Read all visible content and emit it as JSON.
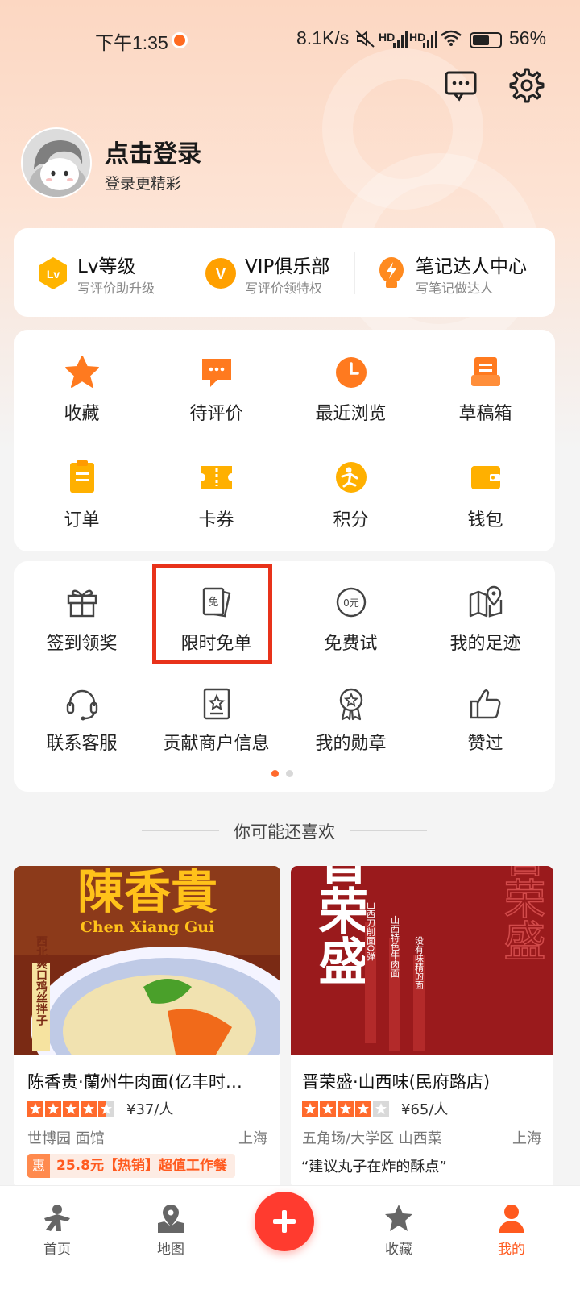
{
  "status_bar": {
    "time": "下午1:35",
    "network_speed": "8.1K/s",
    "signal_1": "HD",
    "signal_2": "HD",
    "battery": "56%"
  },
  "header": {
    "messages_icon": "chat-bubble-icon",
    "settings_icon": "gear-icon"
  },
  "profile": {
    "title": "点击登录",
    "subtitle": "登录更精彩"
  },
  "levels": [
    {
      "title": "Lv等级",
      "subtitle": "写评价助升级",
      "icon": "lv-badge-icon",
      "badge_text": "Lv"
    },
    {
      "title": "VIP俱乐部",
      "subtitle": "写评价领特权",
      "icon": "vip-badge-icon",
      "badge_text": "V"
    },
    {
      "title": "笔记达人中心",
      "subtitle": "写笔记做达人",
      "icon": "lightning-bulb-icon"
    }
  ],
  "grid1": [
    {
      "label": "收藏",
      "icon": "star-icon"
    },
    {
      "label": "待评价",
      "icon": "comment-icon"
    },
    {
      "label": "最近浏览",
      "icon": "clock-icon"
    },
    {
      "label": "草稿箱",
      "icon": "draft-box-icon"
    },
    {
      "label": "订单",
      "icon": "order-icon"
    },
    {
      "label": "卡券",
      "icon": "ticket-icon"
    },
    {
      "label": "积分",
      "icon": "points-icon"
    },
    {
      "label": "钱包",
      "icon": "wallet-icon"
    }
  ],
  "grid2": [
    {
      "label": "签到领奖",
      "icon": "gift-icon"
    },
    {
      "label": "限时免单",
      "icon": "free-order-icon",
      "icon_text": "免"
    },
    {
      "label": "免费试",
      "icon": "free-trial-icon",
      "icon_text": "0元"
    },
    {
      "label": "我的足迹",
      "icon": "map-pin-icon"
    },
    {
      "label": "联系客服",
      "icon": "headset-icon"
    },
    {
      "label": "贡献商户信息",
      "icon": "store-info-icon"
    },
    {
      "label": "我的勋章",
      "icon": "medal-icon"
    },
    {
      "label": "赞过",
      "icon": "thumbs-up-icon"
    }
  ],
  "pager": {
    "pages": 2,
    "active": 0
  },
  "recommend": {
    "title": "你可能还喜欢",
    "items": [
      {
        "name": "陈香贵·蘭州牛肉面(亿丰时…",
        "rating": 4.5,
        "price": "¥37/人",
        "area": "世博园 面馆",
        "city": "上海",
        "deal_tag": "惠",
        "deal": "25.8元【热销】超值工作餐",
        "image_title": "陳香貴",
        "image_subtitle": "Chen Xiang Gui",
        "image_side": "西北爽口鸡丝拌子"
      },
      {
        "name": "晋荣盛·山西味(民府路店)",
        "rating": 4,
        "price": "¥65/人",
        "area": "五角场/大学区 山西菜",
        "city": "上海",
        "quote": "“建议丸子在炸的酥点”",
        "image_title": "晋荣盛",
        "image_col_1": "山西刀削面Q弹",
        "image_col_2": "山西特色牛肉面",
        "image_col_3": "没有味精的面"
      }
    ]
  },
  "bottom_nav": [
    {
      "label": "首页",
      "icon": "home-person-icon"
    },
    {
      "label": "地图",
      "icon": "map-icon"
    },
    {
      "label": "收藏",
      "icon": "star-outline-icon"
    },
    {
      "label": "我的",
      "icon": "profile-icon"
    }
  ],
  "colors": {
    "accent": "#ff6a2c",
    "highlight_box": "#e8321a",
    "fab": "#ff3b2f"
  }
}
